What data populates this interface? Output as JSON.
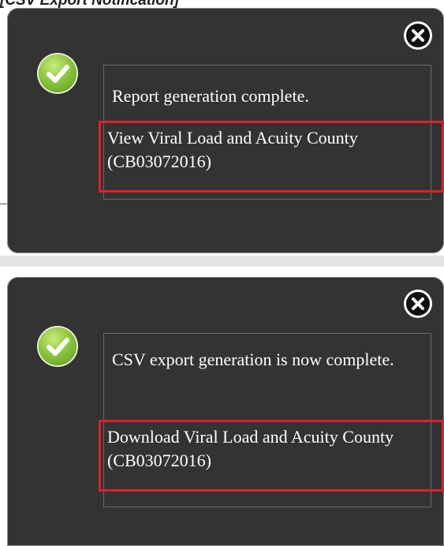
{
  "caption": {
    "text": "[CSV Export Notification]"
  },
  "notifications": [
    {
      "icon": "check-circle-icon",
      "close_icon": "close-circle-icon",
      "message": "Report generation complete.",
      "link": " View Viral Load and Acuity County (CB03072016)"
    },
    {
      "icon": "check-circle-icon",
      "close_icon": "close-circle-icon",
      "message": "CSV export generation is now complete.",
      "link": " Download Viral Load and Acuity County (CB03072016)"
    }
  ],
  "colors": {
    "panel": "#333333",
    "highlight": "#e0202a",
    "success": "#8cc63f"
  }
}
